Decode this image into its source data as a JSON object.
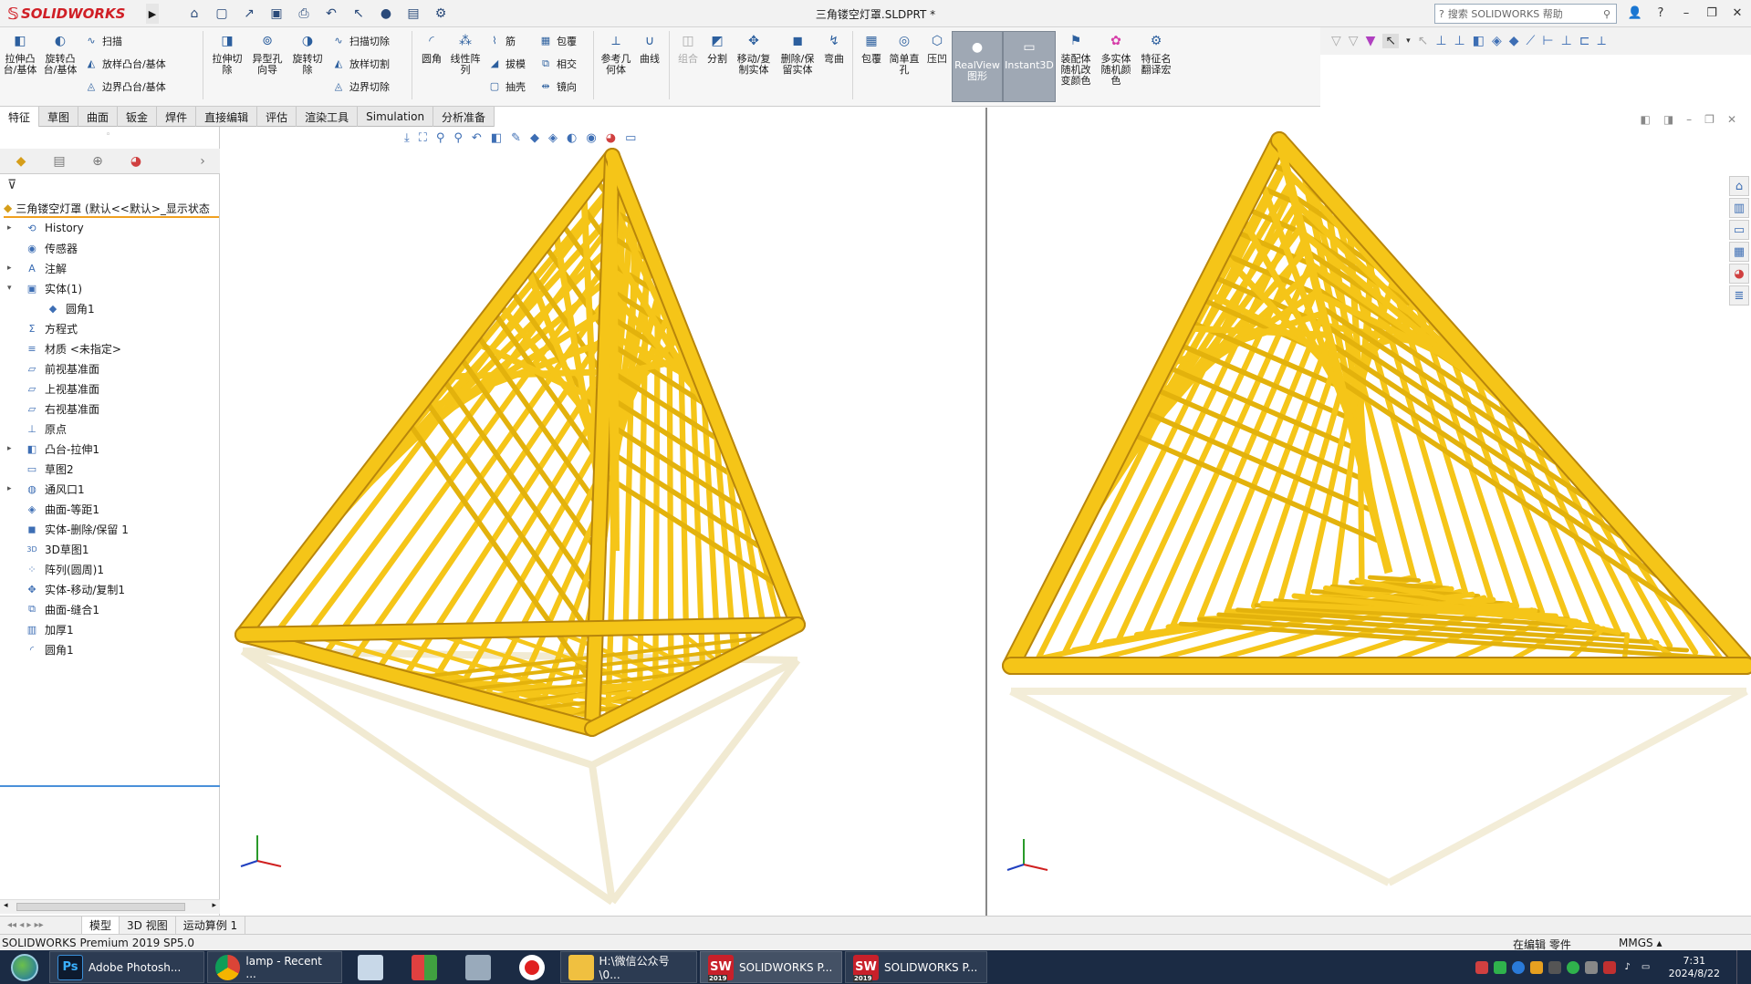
{
  "app": {
    "logo": "SOLIDWORKS",
    "doc_title": "三角镂空灯罩.SLDPRT *",
    "search_placeholder": "搜索 SOLIDWORKS 帮助"
  },
  "commands": {
    "extrude_boss": "拉伸凸台/基体",
    "revolve_boss": "旋转凸台/基体",
    "sweep": "扫描",
    "loft": "放样凸台/基体",
    "boundary": "边界凸台/基体",
    "extrude_cut": "拉伸切除",
    "hole_wizard": "异型孔向导",
    "revolve_cut": "旋转切除",
    "sweep_cut": "扫描切除",
    "loft_cut": "放样切割",
    "boundary_cut": "边界切除",
    "fillet": "圆角",
    "linear_pattern": "线性阵列",
    "rib": "筋",
    "draft": "拔模",
    "shell": "抽壳",
    "wrap": "包覆",
    "intersect": "相交",
    "mirror": "镜向",
    "ref_geometry": "参考几何体",
    "curves": "曲线",
    "combine": "组合",
    "split": "分割",
    "move_copy": "移动/复制实体",
    "delete_keep": "删除/保留实体",
    "flex": "弯曲",
    "wrap2": "包覆",
    "simple_hole": "简单直孔",
    "indent": "压凹",
    "realview": "RealView图形",
    "instant3d": "Instant3D",
    "asm_color": "装配体随机改变颜色",
    "multi_color": "多实体随机颜色",
    "feature_translate": "特征名翻译宏"
  },
  "tabs": [
    "特征",
    "草图",
    "曲面",
    "钣金",
    "焊件",
    "直接编辑",
    "评估",
    "渲染工具",
    "Simulation",
    "分析准备"
  ],
  "active_tab": "特征",
  "tree": {
    "root": "三角镂空灯罩 (默认<<默认>_显示状态",
    "items": [
      {
        "label": "History",
        "icon": "history-icon",
        "expand": "▸"
      },
      {
        "label": "传感器",
        "icon": "sensor-icon",
        "expand": ""
      },
      {
        "label": "注解",
        "icon": "annotation-icon",
        "expand": "▸"
      },
      {
        "label": "实体(1)",
        "icon": "solid-bodies-icon",
        "expand": "▾"
      },
      {
        "label": "圆角1",
        "icon": "body-icon",
        "expand": "",
        "child": true
      },
      {
        "label": "方程式",
        "icon": "equation-icon",
        "expand": ""
      },
      {
        "label": "材质 <未指定>",
        "icon": "material-icon",
        "expand": ""
      },
      {
        "label": "前视基准面",
        "icon": "plane-icon",
        "expand": ""
      },
      {
        "label": "上视基准面",
        "icon": "plane-icon",
        "expand": ""
      },
      {
        "label": "右视基准面",
        "icon": "plane-icon",
        "expand": ""
      },
      {
        "label": "原点",
        "icon": "origin-icon",
        "expand": ""
      },
      {
        "label": "凸台-拉伸1",
        "icon": "extrude-icon",
        "expand": "▸"
      },
      {
        "label": "草图2",
        "icon": "sketch-icon",
        "expand": ""
      },
      {
        "label": "通风口1",
        "icon": "vent-icon",
        "expand": "▸"
      },
      {
        "label": "曲面-等距1",
        "icon": "surface-offset-icon",
        "expand": ""
      },
      {
        "label": "实体-删除/保留 1",
        "icon": "delete-body-icon",
        "expand": ""
      },
      {
        "label": "3D草图1",
        "icon": "3dsketch-icon",
        "expand": ""
      },
      {
        "label": "阵列(圆周)1",
        "icon": "circular-pattern-icon",
        "expand": ""
      },
      {
        "label": "实体-移动/复制1",
        "icon": "move-body-icon",
        "expand": ""
      },
      {
        "label": "曲面-缝合1",
        "icon": "knit-icon",
        "expand": ""
      },
      {
        "label": "加厚1",
        "icon": "thicken-icon",
        "expand": ""
      },
      {
        "label": "圆角1",
        "icon": "fillet-icon",
        "expand": ""
      }
    ]
  },
  "bottom_tabs": [
    "模型",
    "3D 视图",
    "运动算例 1"
  ],
  "status": {
    "app": "SOLIDWORKS Premium 2019 SP5.0",
    "mode": "在编辑 零件",
    "units": "MMGS"
  },
  "taskbar": {
    "items": [
      {
        "label": "Adobe Photosh...",
        "icon": "Ps"
      },
      {
        "label": "lamp - Recent ...",
        "icon": "chrome-icon"
      },
      {
        "label": "H:\\微信公众号\\0...",
        "icon": "folder-icon"
      },
      {
        "label": "SOLIDWORKS P...",
        "icon": "SW"
      },
      {
        "label": "SOLIDWORKS P...",
        "icon": "SW"
      }
    ],
    "year_badge": "2019",
    "time": "7:31",
    "date": "2024/8/22"
  },
  "colors": {
    "accent": "#d01f26",
    "part": "#f5c518",
    "part_dark": "#b8860b",
    "taskbar": "#1b2b44"
  }
}
